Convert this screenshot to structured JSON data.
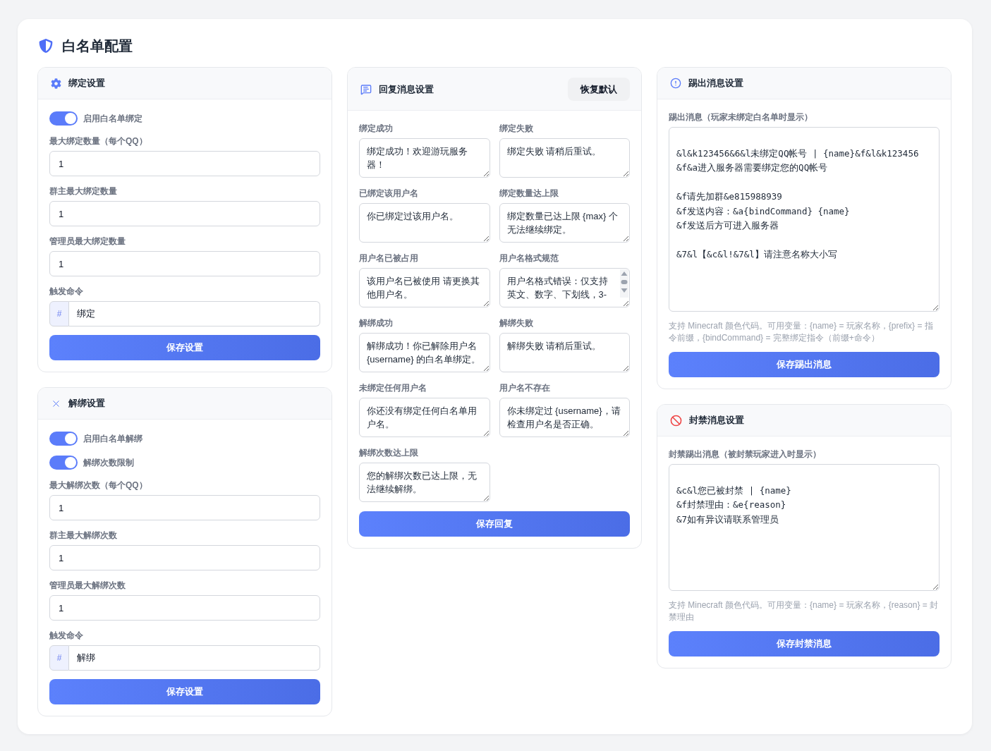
{
  "title": "白名单配置",
  "bind_settings": {
    "title": "绑定设置",
    "toggles": [
      {
        "label": "启用白名单绑定",
        "on": true
      }
    ],
    "fields": [
      {
        "label": "最大绑定数量（每个QQ）",
        "value": "1"
      },
      {
        "label": "群主最大绑定数量",
        "value": "1"
      },
      {
        "label": "管理员最大绑定数量",
        "value": "1"
      }
    ],
    "command": {
      "label": "触发命令",
      "prefix": "#",
      "value": "绑定"
    },
    "save_button": "保存设置"
  },
  "unbind_settings": {
    "title": "解绑设置",
    "toggles": [
      {
        "label": "启用白名单解绑",
        "on": true
      },
      {
        "label": "解绑次数限制",
        "on": true
      }
    ],
    "fields": [
      {
        "label": "最大解绑次数（每个QQ）",
        "value": "1"
      },
      {
        "label": "群主最大解绑次数",
        "value": "1"
      },
      {
        "label": "管理员最大解绑次数",
        "value": "1"
      }
    ],
    "command": {
      "label": "触发命令",
      "prefix": "#",
      "value": "解绑"
    },
    "save_button": "保存设置"
  },
  "reply_settings": {
    "title": "回复消息设置",
    "reset_button": "恢复默认",
    "messages": [
      {
        "label": "绑定成功",
        "value": "绑定成功！欢迎游玩服务器！",
        "scrollbar": false
      },
      {
        "label": "绑定失败",
        "value": "绑定失败 请稍后重试。",
        "scrollbar": false
      },
      {
        "label": "已绑定该用户名",
        "value": "你已绑定过该用户名。",
        "scrollbar": false
      },
      {
        "label": "绑定数量达上限",
        "value": "绑定数量已达上限 {max} 个无法继续绑定。",
        "scrollbar": false
      },
      {
        "label": "用户名已被占用",
        "value": "该用户名已被使用 请更换其他用户名。",
        "scrollbar": false
      },
      {
        "label": "用户名格式规范",
        "value": "用户名格式错误：仅支持英文、数字、下划线，3-",
        "scrollbar": true
      },
      {
        "label": "解绑成功",
        "value": "解绑成功！你已解除用户名 {username} 的白名单绑定。",
        "scrollbar": false
      },
      {
        "label": "解绑失败",
        "value": "解绑失败 请稍后重试。",
        "scrollbar": false
      },
      {
        "label": "未绑定任何用户名",
        "value": "你还没有绑定任何白名单用户名。",
        "scrollbar": false
      },
      {
        "label": "用户名不存在",
        "value": "你未绑定过 {username}，请检查用户名是否正确。",
        "scrollbar": false
      },
      {
        "label": "解绑次数达上限",
        "value": "您的解绑次数已达上限，无法继续解绑。",
        "scrollbar": false
      }
    ],
    "save_button": "保存回复"
  },
  "kick_settings": {
    "title": "踢出消息设置",
    "field_label": "踢出消息（玩家未绑定白名单时显示）",
    "value": "\n&l&k123456&6&l未绑定QQ帐号 | {name}&f&l&k123456\n&f&a进入服务器需要绑定您的QQ帐号\n\n&f请先加群&e815988939\n&f发送内容：&a{bindCommand} {name}\n&f发送后方可进入服务器\n\n&7&l【&c&l!&7&l】请注意名称大小写",
    "help": "支持 Minecraft 颜色代码。可用变量：{name} = 玩家名称，{prefix} = 指令前缀，{bindCommand} = 完整绑定指令（前缀+命令）",
    "save_button": "保存踢出消息"
  },
  "ban_settings": {
    "title": "封禁消息设置",
    "field_label": "封禁踢出消息（被封禁玩家进入时显示）",
    "value": "\n&c&l您已被封禁 | {name}\n&f封禁理由：&e{reason}\n&7如有异议请联系管理员",
    "help": "支持 Minecraft 颜色代码。可用变量：{name} = 玩家名称，{reason} = 封禁理由",
    "save_button": "保存封禁消息"
  }
}
